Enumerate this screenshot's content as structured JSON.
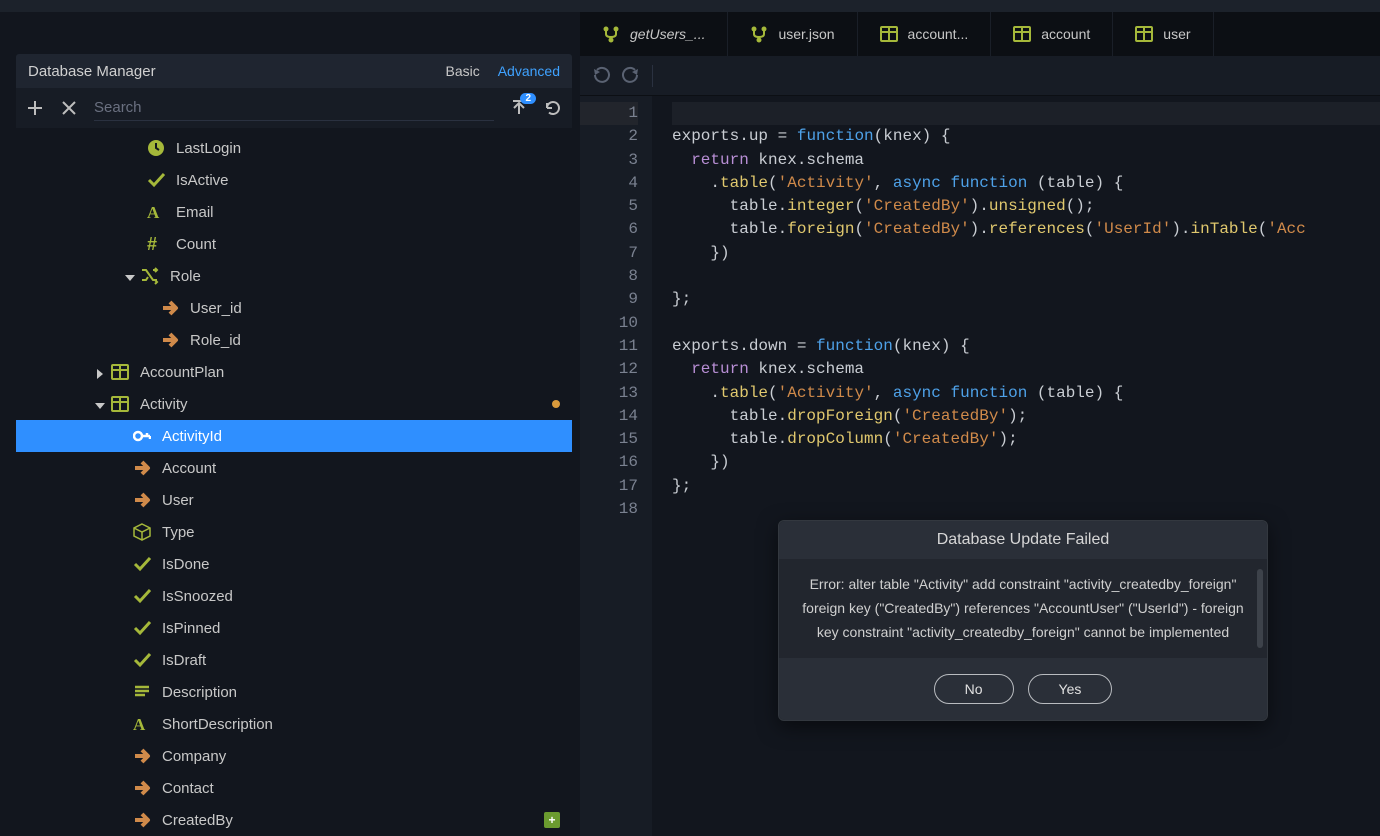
{
  "panel": {
    "title": "Database Manager",
    "mode_basic": "Basic",
    "mode_advanced": "Advanced",
    "search_placeholder": "Search",
    "sync_badge": "2"
  },
  "tree": [
    {
      "indent": 130,
      "icon": "clock",
      "label": "LastLogin"
    },
    {
      "indent": 130,
      "icon": "check",
      "label": "IsActive"
    },
    {
      "indent": 130,
      "icon": "font",
      "label": "Email"
    },
    {
      "indent": 130,
      "icon": "hash",
      "label": "Count"
    },
    {
      "indent": 102,
      "caret": "down",
      "icon": "shuffle",
      "label": "Role"
    },
    {
      "indent": 144,
      "icon": "arrow",
      "label": "User_id"
    },
    {
      "indent": 144,
      "icon": "arrow",
      "label": "Role_id"
    },
    {
      "indent": 72,
      "caret": "right",
      "icon": "table",
      "label": "AccountPlan"
    },
    {
      "indent": 72,
      "caret": "down",
      "icon": "table",
      "label": "Activity",
      "trailing": "dot"
    },
    {
      "indent": 116,
      "icon": "key",
      "label": "ActivityId",
      "selected": true
    },
    {
      "indent": 116,
      "icon": "arrow",
      "label": "Account"
    },
    {
      "indent": 116,
      "icon": "arrow",
      "label": "User"
    },
    {
      "indent": 116,
      "icon": "cube",
      "label": "Type"
    },
    {
      "indent": 116,
      "icon": "check",
      "label": "IsDone"
    },
    {
      "indent": 116,
      "icon": "check",
      "label": "IsSnoozed"
    },
    {
      "indent": 116,
      "icon": "check",
      "label": "IsPinned"
    },
    {
      "indent": 116,
      "icon": "check",
      "label": "IsDraft"
    },
    {
      "indent": 116,
      "icon": "lines",
      "label": "Description"
    },
    {
      "indent": 116,
      "icon": "font",
      "label": "ShortDescription"
    },
    {
      "indent": 116,
      "icon": "arrow",
      "label": "Company"
    },
    {
      "indent": 116,
      "icon": "arrow",
      "label": "Contact"
    },
    {
      "indent": 116,
      "icon": "arrow",
      "label": "CreatedBy",
      "trailing": "add"
    }
  ],
  "tabs": [
    {
      "icon": "branch",
      "label": "getUsers_...",
      "active": true
    },
    {
      "icon": "branch",
      "label": "user.json"
    },
    {
      "icon": "table",
      "label": "account..."
    },
    {
      "icon": "table",
      "label": "account"
    },
    {
      "icon": "table",
      "label": "user"
    }
  ],
  "code_lines": 18,
  "dialog": {
    "title": "Database Update Failed",
    "body": "Error: alter table \"Activity\" add constraint \"activity_createdby_foreign\" foreign key (\"CreatedBy\") references \"AccountUser\" (\"UserId\") - foreign key constraint \"activity_createdby_foreign\" cannot be implemented",
    "no": "No",
    "yes": "Yes"
  }
}
